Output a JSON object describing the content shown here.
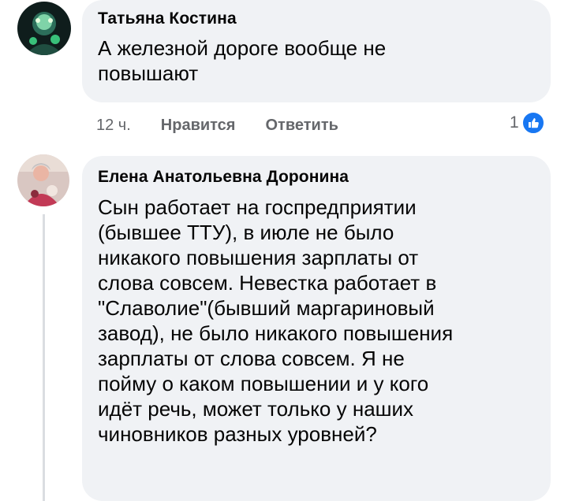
{
  "comments": [
    {
      "author": "Татьяна Костина",
      "text": "А железной дороге вообще не\nповышают",
      "time": "12 ч.",
      "like_label": "Нравится",
      "reply_label": "Ответить",
      "reaction_count": "1",
      "reaction_icon": "like-icon"
    },
    {
      "author": "Елена Анатольевна Доронина",
      "text": "Сын работает на госпредприятии\n(бывшее ТТУ), в июле не было\nникакого повышения зарплаты от\nслова совсем. Невестка работает в\n\"Славолие\"(бывший маргариновый\nзавод), не было никакого повышения\nзарплаты от слова совсем. Я не\nпойму о каком повышении и у кого\nидёт речь, может только у наших\nчиновников разных уровней?"
    }
  ],
  "colors": {
    "bubble": "#f0f2f5",
    "meta_text": "#65676b",
    "like_blue": "#1877f2"
  }
}
